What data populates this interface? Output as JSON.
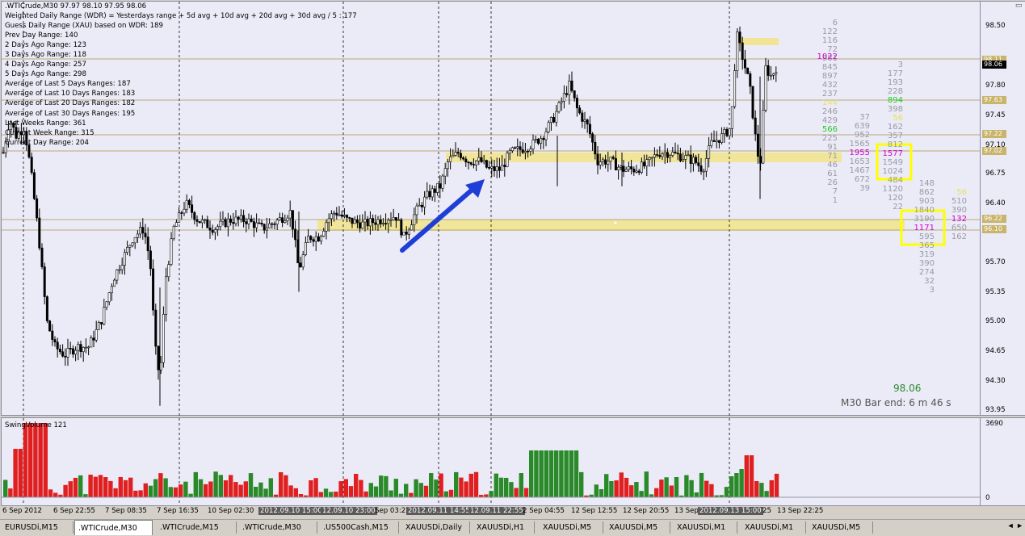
{
  "chart_header": ".WTICrude,M30  97.97 98.10 97.95 98.06",
  "info_lines": [
    "Weighted Daily Range (WDR) = Yesterdays range + 5d avg + 10d avg + 20d avg + 30d avg / 5 : 177",
    "Guess Daily Range (XAU) based on WDR: 189",
    "Prev Day Range: 140",
    "2 Days Ago Range: 123",
    "3 Days Ago Range: 118",
    "4 Days Ago Range: 257",
    "5 Days Ago Range: 298",
    "Average of Last 5 Days Ranges: 187",
    "Average of Last 10 Days Ranges: 183",
    "Average of Last 20 Days Ranges: 182",
    "Average of Last 30 Days Ranges: 195",
    "Last Weeks Range: 361",
    "Current Week Range: 315",
    "Current Day Range: 204"
  ],
  "price_scale": [
    "98.50",
    "97.80",
    "97.45",
    "97.10",
    "96.75",
    "96.40",
    "95.70",
    "95.35",
    "95.00",
    "94.65",
    "94.30",
    "93.95"
  ],
  "price_labels": [
    {
      "text": "98.11",
      "bg": "#c8b46a"
    },
    {
      "text": "98.06",
      "bg": "#000000"
    },
    {
      "text": "97.63",
      "bg": "#c8b46a"
    },
    {
      "text": "97.22",
      "bg": "#c8b46a"
    },
    {
      "text": "97.02",
      "bg": "#c8b46a"
    },
    {
      "text": "96.22",
      "bg": "#c8b46a"
    },
    {
      "text": "96.10",
      "bg": "#c8b46a"
    }
  ],
  "volume_title": "SwingVolume 121",
  "volume_scale": {
    "max": "3690",
    "zero": "0"
  },
  "time_labels": [
    {
      "text": "6 Sep 2012",
      "hl": false
    },
    {
      "text": "6 Sep 22:55",
      "hl": false
    },
    {
      "text": "7 Sep 08:35",
      "hl": false
    },
    {
      "text": "7 Sep 16:35",
      "hl": false
    },
    {
      "text": "10 Sep 02:30",
      "hl": false
    },
    {
      "text": "2012.09.10 15:00",
      "hl": true
    },
    {
      "text": "12.09.10 23:00",
      "hl": true
    },
    {
      "text": "Sep 03:25",
      "hl": false
    },
    {
      "text": "2012.09.11 14:55",
      "hl": true
    },
    {
      "text": "12.09.11 22:55",
      "hl": true
    },
    {
      "text": "2 Sep 04:55",
      "hl": false
    },
    {
      "text": "12 Sep 12:55",
      "hl": false
    },
    {
      "text": "12 Sep 20:55",
      "hl": false
    },
    {
      "text": "13 Sep",
      "hl": false
    },
    {
      "text": "2012.09.13 15:00",
      "hl": true
    },
    {
      "text": "25",
      "hl": false
    },
    {
      "text": "13 Sep 22:25",
      "hl": false
    }
  ],
  "current_price": "98.06",
  "bar_end": "M30 Bar end: 6 m 46 s",
  "tabs": [
    {
      "label": "EURUSDi,M15",
      "active": false
    },
    {
      "label": ".WTICrude,M30",
      "active": true
    },
    {
      "label": ".WTICrude,M15",
      "active": false
    },
    {
      "label": ".WTICrude,M30",
      "active": false
    },
    {
      "label": ".US500Cash,M15",
      "active": false
    },
    {
      "label": "XAUUSDi,Daily",
      "active": false
    },
    {
      "label": "XAUUSDi,H1",
      "active": false
    },
    {
      "label": "XAUUSDi,M5",
      "active": false
    },
    {
      "label": "XAUUSDi,M5",
      "active": false
    },
    {
      "label": "XAUUSDi,M1",
      "active": false
    },
    {
      "label": "XAUUSDi,M1",
      "active": false
    },
    {
      "label": "XAUUSDi,M5",
      "active": false
    }
  ],
  "profile_numbers": {
    "col1": [
      "6",
      "122",
      "116",
      "72",
      "581",
      "845",
      "897",
      "432",
      "237",
      "144",
      "246",
      "429",
      "566",
      "225",
      "91",
      "71",
      "46",
      "61",
      "26",
      "7",
      "1"
    ],
    "col2": [
      "37",
      "639",
      "952",
      "1565",
      "1955",
      "1653",
      "1467",
      "672",
      "39"
    ],
    "col3": [
      "3",
      "177",
      "193",
      "228",
      "894",
      "398",
      "56",
      "162",
      "357",
      "812",
      "1577",
      "1549",
      "1024",
      "484",
      "1120",
      "120",
      "22"
    ],
    "col4": [
      "148",
      "862",
      "903",
      "1840",
      "3190",
      "1171",
      "595",
      "365",
      "319",
      "390",
      "274",
      "32",
      "3"
    ],
    "col5": [
      "56",
      "510",
      "390",
      "132",
      "650",
      "162"
    ],
    "highlight": {
      "v1022": "1022",
      "v894": "894",
      "v566": "566",
      "v1955": "1955",
      "v1577": "1577",
      "v1171": "1171",
      "v132": "132",
      "v144": "144",
      "v56": "56"
    }
  },
  "colors": {
    "up_volume": "#2a8a2a",
    "down_volume": "#e02020",
    "zone": "#f2e48a",
    "arrow": "#1f3ed6",
    "box": "#ffff00"
  }
}
